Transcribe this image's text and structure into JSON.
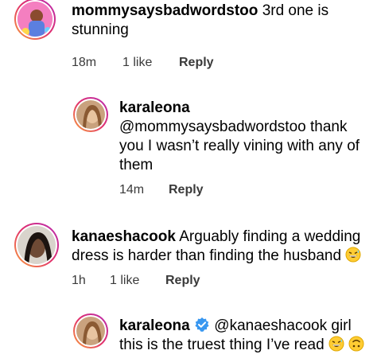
{
  "comments": [
    {
      "username": "mommysaysbadwordstoo",
      "text": "3rd one is stunning",
      "time": "18m",
      "likes": "1 like",
      "reply": "Reply"
    },
    {
      "username": "karaleona",
      "text": "@mommysaysbadwordstoo thank you I wasn’t really vining with any of them",
      "time": "14m",
      "reply": "Reply"
    },
    {
      "username": "kanaeshacook",
      "text": "Arguably finding a wedding dress is harder than finding the husband",
      "time": "1h",
      "likes": "1 like",
      "reply": "Reply"
    },
    {
      "username": "karaleona",
      "text": "@kanaeshacook girl this is the truest thing I’ve read",
      "verified": true
    }
  ],
  "colors": {
    "ring_start": "#f9a23a",
    "ring_mid": "#e1306c",
    "ring_end": "#b62bb5",
    "verified_blue": "#3897f0",
    "meta_text": "#3a3a3a"
  }
}
